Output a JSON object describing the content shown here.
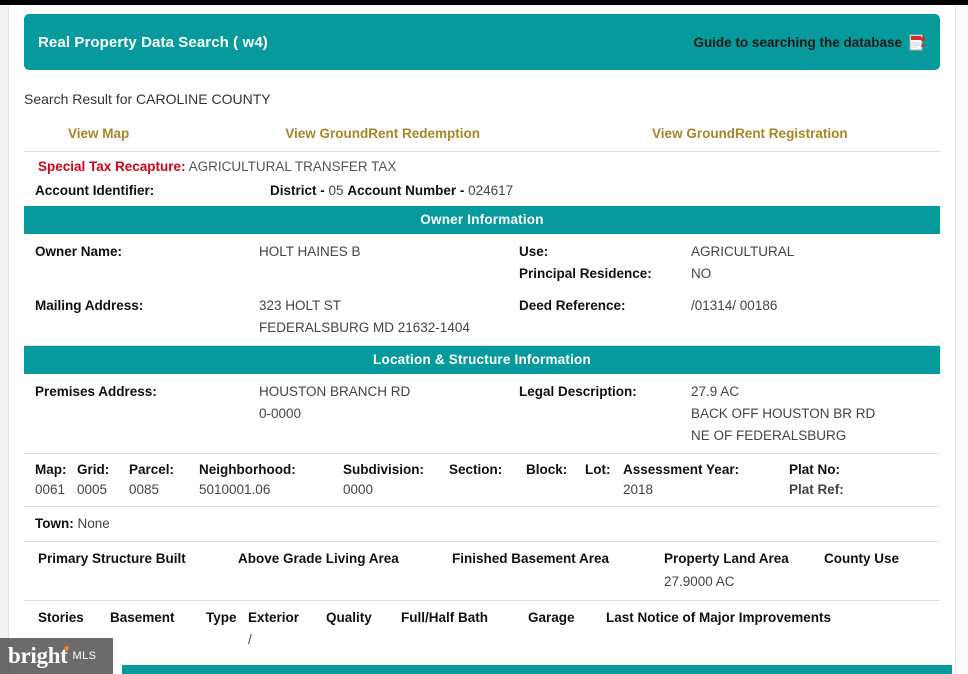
{
  "header": {
    "title": "Real Property Data Search ( w4)",
    "guide_link": "Guide to searching the database",
    "pdf_icon": "pdf-icon"
  },
  "search_result": "Search Result for CAROLINE COUNTY",
  "links": {
    "view_map": "View Map",
    "view_groundrent_redemption": "View GroundRent Redemption",
    "view_groundrent_registration": "View GroundRent Registration"
  },
  "special_tax": {
    "label": "Special Tax Recapture:",
    "value": "AGRICULTURAL TRANSFER TAX"
  },
  "account": {
    "label": "Account Identifier:",
    "district_label": "District -",
    "district_value": "05",
    "account_number_label": "Account Number -",
    "account_number_value": "024617"
  },
  "owner_section": {
    "title": "Owner Information",
    "owner_name_label": "Owner Name:",
    "owner_name_value": "HOLT HAINES B",
    "use_label": "Use:",
    "use_value": "AGRICULTURAL",
    "principal_residence_label": "Principal Residence:",
    "principal_residence_value": "NO",
    "mailing_address_label": "Mailing Address:",
    "mailing_address_line1": "323 HOLT ST",
    "mailing_address_line2": "FEDERALSBURG MD 21632-1404",
    "deed_reference_label": "Deed Reference:",
    "deed_reference_value": "/01314/ 00186"
  },
  "location_section": {
    "title": "Location & Structure Information",
    "premises_address_label": "Premises Address:",
    "premises_address_line1": "HOUSTON BRANCH RD",
    "premises_address_line2": "0-0000",
    "legal_description_label": "Legal Description:",
    "legal_description_line1": "27.9 AC",
    "legal_description_line2": "BACK OFF HOUSTON BR RD",
    "legal_description_line3": "NE OF FEDERALSBURG"
  },
  "parcel_table": {
    "headers": [
      "Map:",
      "Grid:",
      "Parcel:",
      "Neighborhood:",
      "Subdivision:",
      "Section:",
      "Block:",
      "Lot:",
      "Assessment Year:",
      "Plat No:"
    ],
    "values": [
      "0061",
      "0005",
      "0085",
      "5010001.06",
      "0000",
      "",
      "",
      "",
      "2018",
      "Plat Ref:"
    ]
  },
  "town": {
    "label": "Town:",
    "value": "None"
  },
  "structure_table": {
    "headers": [
      "Primary Structure Built",
      "Above Grade Living Area",
      "Finished Basement Area",
      "Property Land Area",
      "County Use"
    ],
    "values": [
      "",
      "",
      "",
      "27.9000 AC",
      ""
    ]
  },
  "rooms_table": {
    "headers": [
      "Stories",
      "Basement",
      "Type",
      "Exterior",
      "Quality",
      "Full/Half Bath",
      "Garage",
      "Last Notice of Major Improvements"
    ],
    "values": [
      "",
      "",
      "",
      "/",
      "",
      "",
      "",
      ""
    ]
  },
  "watermark": {
    "bright": "bright",
    "mls": "MLS"
  },
  "colors": {
    "teal": "#079a9c",
    "gold_link": "#a8852a",
    "red_label": "#d0021b",
    "watermark_accent": "#f07e26"
  }
}
